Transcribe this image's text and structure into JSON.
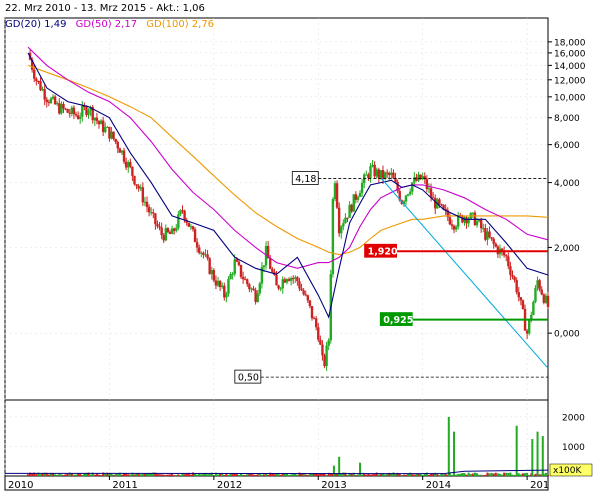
{
  "chart_data": {
    "type": "candlestick",
    "header": "22. Mrz 2010 - 13. Mrz 2015 - Akt.: 1,06",
    "legend": [
      {
        "label": "GD(20)",
        "value": "1,49",
        "color": "#000080"
      },
      {
        "label": "GD(50)",
        "value": "2,17",
        "color": "#cc00cc"
      },
      {
        "label": "GD(100)",
        "value": "2,76",
        "color": "#ee9900"
      }
    ],
    "x_tick_labels": [
      "2010",
      "2011",
      "2012",
      "2013",
      "2014",
      "201"
    ],
    "y_tick_labels": [
      "18,000",
      "16,000",
      "14,000",
      "12,000",
      "10,000",
      "8,000",
      "6,000",
      "4,000",
      "2,000",
      "0,000"
    ],
    "volume_tick_labels": [
      "2000",
      "1000"
    ],
    "volume_unit": "x100K",
    "annotations": [
      {
        "label": "4,18",
        "value": 4.18,
        "style": "dashed",
        "color": "#000000"
      },
      {
        "label": "0,50",
        "value": 0.5,
        "style": "dashed",
        "color": "#000000"
      },
      {
        "label": "1,920",
        "value": 1.92,
        "style": "solid",
        "color": "#e00000"
      },
      {
        "label": "0,925",
        "value": 0.925,
        "style": "solid",
        "color": "#009900"
      }
    ],
    "scale": "log",
    "last_price": 1.06,
    "price_series": {
      "x": [
        2010.22,
        2010.3,
        2010.4,
        2010.5,
        2010.6,
        2010.7,
        2010.8,
        2010.9,
        2011.0,
        2011.1,
        2011.2,
        2011.3,
        2011.4,
        2011.5,
        2011.6,
        2011.7,
        2011.8,
        2011.9,
        2012.0,
        2012.1,
        2012.2,
        2012.3,
        2012.4,
        2012.5,
        2012.6,
        2012.7,
        2012.8,
        2012.9,
        2013.0,
        2013.05,
        2013.1,
        2013.15,
        2013.2,
        2013.3,
        2013.4,
        2013.5,
        2013.6,
        2013.7,
        2013.8,
        2013.9,
        2014.0,
        2014.1,
        2014.2,
        2014.3,
        2014.4,
        2014.5,
        2014.6,
        2014.7,
        2014.8,
        2014.9,
        2015.0,
        2015.1,
        2015.2
      ],
      "close": [
        16,
        12,
        10,
        9,
        8.5,
        8.2,
        9,
        7.5,
        6.8,
        5.8,
        4.6,
        3.6,
        2.8,
        2.3,
        2.3,
        3.0,
        2.3,
        1.85,
        1.45,
        1.2,
        1.7,
        1.4,
        1.2,
        1.9,
        1.3,
        1.5,
        1.4,
        1.1,
        0.8,
        0.55,
        0.75,
        4.8,
        2.5,
        3.0,
        3.8,
        4.6,
        4.3,
        4.3,
        3.3,
        4.0,
        4.2,
        3.3,
        2.9,
        2.6,
        2.8,
        2.7,
        2.3,
        2.0,
        1.8,
        1.3,
        0.8,
        1.4,
        1.06
      ]
    },
    "moving_averages": {
      "x": [
        2010.22,
        2010.4,
        2010.6,
        2010.8,
        2011.0,
        2011.2,
        2011.4,
        2011.6,
        2011.8,
        2012.0,
        2012.2,
        2012.4,
        2012.6,
        2012.8,
        2013.0,
        2013.1,
        2013.2,
        2013.3,
        2013.4,
        2013.5,
        2013.6,
        2013.7,
        2013.8,
        2013.9,
        2014.0,
        2014.2,
        2014.4,
        2014.6,
        2014.8,
        2015.0,
        2015.2
      ],
      "gd20": [
        16,
        11,
        9.5,
        9.0,
        8.0,
        5.5,
        4.0,
        2.8,
        2.6,
        2.4,
        1.8,
        1.6,
        1.5,
        1.8,
        1.2,
        0.95,
        1.6,
        2.6,
        3.2,
        3.9,
        4.0,
        4.1,
        3.8,
        3.9,
        3.7,
        3.0,
        2.7,
        2.7,
        2.1,
        1.6,
        1.49
      ],
      "gd50": [
        17,
        14,
        12,
        10.5,
        9.5,
        8.0,
        6.2,
        4.6,
        3.6,
        3.0,
        2.4,
        2.0,
        1.7,
        1.6,
        1.7,
        1.7,
        1.8,
        2.0,
        2.5,
        3.0,
        3.4,
        3.6,
        3.8,
        3.9,
        3.9,
        3.7,
        3.4,
        3.0,
        2.7,
        2.3,
        2.17
      ],
      "gd100": [
        14,
        13,
        12,
        11,
        10,
        9.0,
        8.0,
        6.5,
        5.3,
        4.3,
        3.5,
        2.9,
        2.5,
        2.2,
        2.0,
        1.9,
        1.85,
        1.9,
        2.0,
        2.2,
        2.4,
        2.5,
        2.6,
        2.7,
        2.7,
        2.8,
        2.8,
        2.8,
        2.8,
        2.8,
        2.76
      ]
    },
    "volume": {
      "x": [
        2013.15,
        2013.2,
        2013.4,
        2014.25,
        2014.3,
        2014.9,
        2015.05,
        2015.1,
        2015.15
      ],
      "value": [
        350,
        650,
        450,
        2000,
        1500,
        1700,
        1250,
        1500,
        1350
      ]
    },
    "trendlines": [
      {
        "color": "#00aadd",
        "from": [
          2013.6,
          4.2
        ],
        "to": [
          2015.2,
          0.55
        ]
      }
    ]
  }
}
